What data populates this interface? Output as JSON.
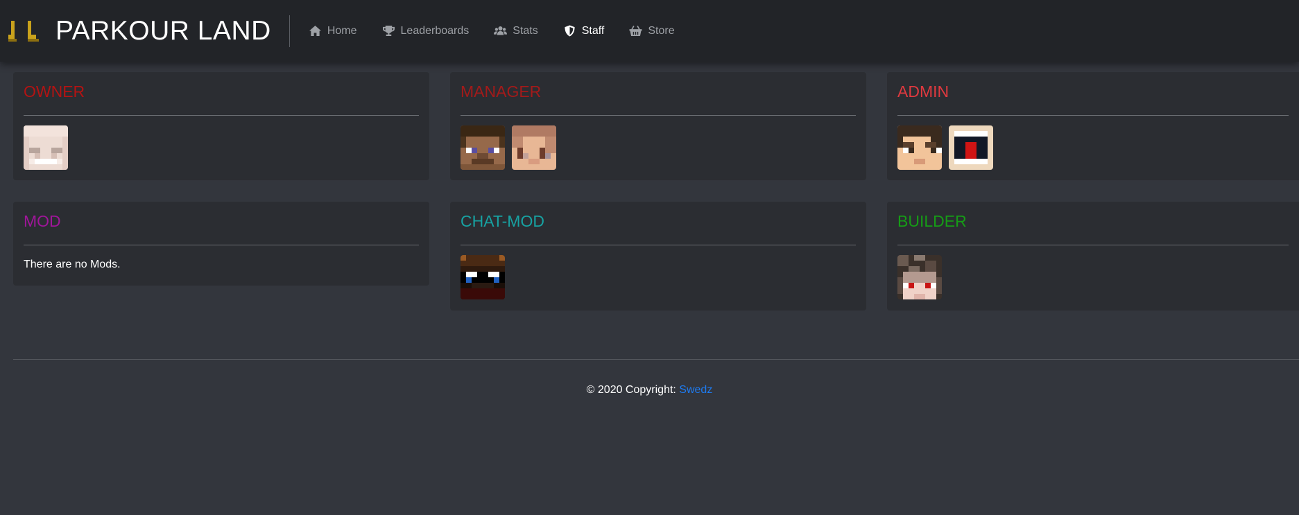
{
  "brand": {
    "title": "PARKOUR LAND",
    "logo_icon": "boots-logo",
    "logo_color": "#c9a21c"
  },
  "nav": {
    "items": [
      {
        "label": "Home",
        "icon": "home-icon",
        "active": false
      },
      {
        "label": "Leaderboards",
        "icon": "trophy-icon",
        "active": false
      },
      {
        "label": "Stats",
        "icon": "users-icon",
        "active": false
      },
      {
        "label": "Staff",
        "icon": "shield-icon",
        "active": true
      },
      {
        "label": "Store",
        "icon": "basket-icon",
        "active": false
      }
    ]
  },
  "ranks": [
    {
      "title": "OWNER",
      "color": "#b31313",
      "heads": 1
    },
    {
      "title": "MANAGER",
      "color": "#a31a1a",
      "heads": 2
    },
    {
      "title": "ADMIN",
      "color": "#e0393f",
      "heads": 2
    },
    {
      "title": "MOD",
      "color": "#a0169a",
      "heads": 0,
      "empty_text": "There are no Mods."
    },
    {
      "title": "CHAT-MOD",
      "color": "#17a2a2",
      "heads": 1
    },
    {
      "title": "BUILDER",
      "color": "#169c16",
      "heads": 1
    }
  ],
  "footer": {
    "prefix": "© 2020 Copyright: ",
    "link": "Swedz",
    "link_color": "#1e7bf0"
  }
}
